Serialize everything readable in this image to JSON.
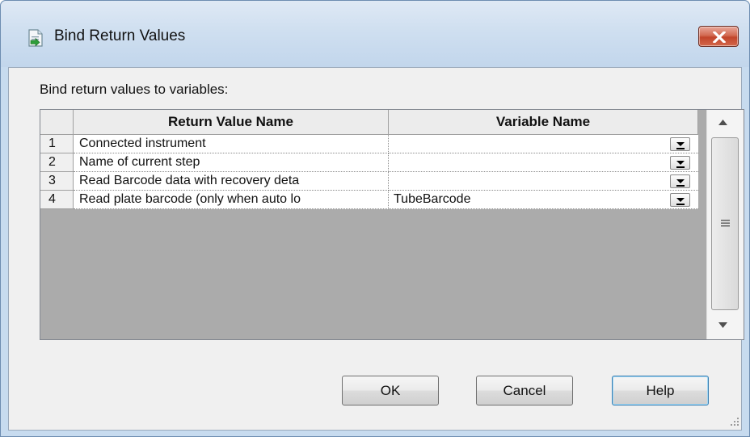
{
  "window": {
    "title": "Bind Return Values",
    "icon": "document-icon",
    "close_icon": "close-icon"
  },
  "prompt": "Bind return values to variables:",
  "table": {
    "columns": [
      "Return Value Name",
      "Variable Name"
    ],
    "rows": [
      {
        "num": "1",
        "name": "Connected instrument",
        "variable": ""
      },
      {
        "num": "2",
        "name": "Name of current step",
        "variable": ""
      },
      {
        "num": "3",
        "name": "Read Barcode data with recovery deta",
        "variable": ""
      },
      {
        "num": "4",
        "name": "Read plate barcode (only when auto lo",
        "variable": "TubeBarcode"
      }
    ]
  },
  "buttons": {
    "ok": "OK",
    "cancel": "Cancel",
    "help": "Help"
  },
  "colors": {
    "close_button": "#c2452b",
    "frame": "#c7dbef"
  }
}
